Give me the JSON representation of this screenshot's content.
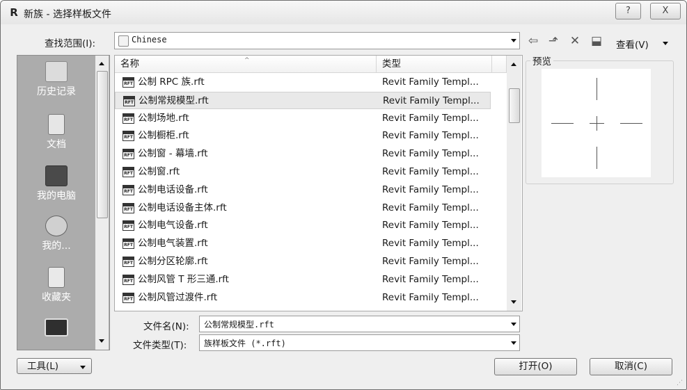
{
  "window": {
    "app_icon": "R",
    "title": "新族 - 选择样板文件",
    "help_button": "?",
    "close_button": "X"
  },
  "lookin": {
    "label": "查找范围(I):",
    "value": "Chinese"
  },
  "toolbar": {
    "back_icon": "⇦",
    "up_icon": "⬏",
    "delete_icon": "✕",
    "new_folder_icon": "⬓",
    "view_label": "查看(V)"
  },
  "places": [
    {
      "label": "历史记录",
      "icon": "history-icon"
    },
    {
      "label": "文档",
      "icon": "documents-icon"
    },
    {
      "label": "我的电脑",
      "icon": "computer-icon"
    },
    {
      "label": "我的...",
      "icon": "network-icon"
    },
    {
      "label": "收藏夹",
      "icon": "favorites-icon"
    },
    {
      "label": "",
      "icon": "desktop-icon"
    }
  ],
  "columns": {
    "name": "名称",
    "type": "类型"
  },
  "files": [
    {
      "name": "公制 RPC 族.rft",
      "type": "Revit Family Templ..."
    },
    {
      "name": "公制常规模型.rft",
      "type": "Revit Family Templ..."
    },
    {
      "name": "公制场地.rft",
      "type": "Revit Family Templ..."
    },
    {
      "name": "公制橱柜.rft",
      "type": "Revit Family Templ..."
    },
    {
      "name": "公制窗 - 幕墙.rft",
      "type": "Revit Family Templ..."
    },
    {
      "name": "公制窗.rft",
      "type": "Revit Family Templ..."
    },
    {
      "name": "公制电话设备.rft",
      "type": "Revit Family Templ..."
    },
    {
      "name": "公制电话设备主体.rft",
      "type": "Revit Family Templ..."
    },
    {
      "name": "公制电气设备.rft",
      "type": "Revit Family Templ..."
    },
    {
      "name": "公制电气装置.rft",
      "type": "Revit Family Templ..."
    },
    {
      "name": "公制分区轮廓.rft",
      "type": "Revit Family Templ..."
    },
    {
      "name": "公制风管 T 形三通.rft",
      "type": "Revit Family Templ..."
    },
    {
      "name": "公制风管过渡件.rft",
      "type": "Revit Family Templ..."
    }
  ],
  "selected_index": 1,
  "file_icon_text": "RFT",
  "preview": {
    "label": "预览"
  },
  "filename": {
    "label": "文件名(N):",
    "value": "公制常规模型.rft"
  },
  "filetype": {
    "label": "文件类型(T):",
    "value": "族样板文件 (*.rft)"
  },
  "buttons": {
    "tools": "工具(L)",
    "open": "打开(O)",
    "cancel": "取消(C)"
  }
}
